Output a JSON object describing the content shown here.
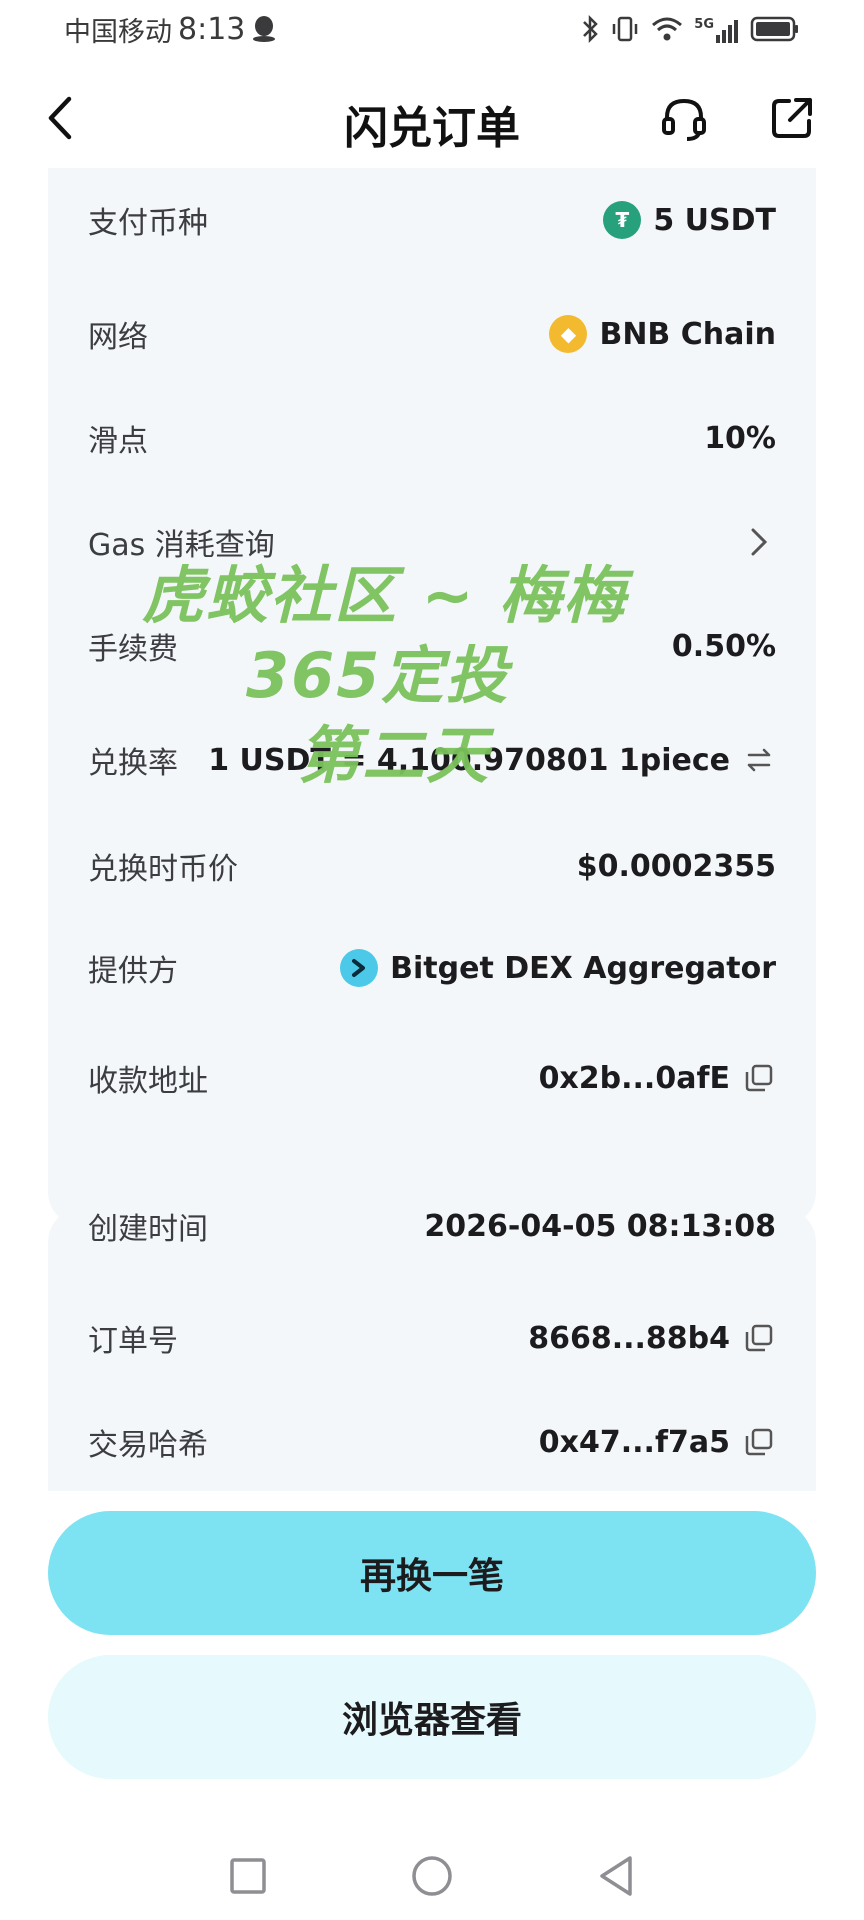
{
  "status_bar": {
    "carrier": "中国移动",
    "time": "8:13",
    "network_label": "5G"
  },
  "header": {
    "title": "闪兑订单"
  },
  "card1": {
    "rows": [
      {
        "label": "支付币种",
        "value": "5 USDT",
        "icon": "usdt-icon"
      },
      {
        "label": "网络",
        "value": "BNB Chain",
        "icon": "bnb-icon"
      },
      {
        "label": "滑点",
        "value": "10%"
      },
      {
        "label": "Gas 消耗查询",
        "value": ""
      },
      {
        "label": "手续费",
        "value": "0.50%"
      }
    ]
  },
  "card2": {
    "rows": [
      {
        "label": "兑换率",
        "value": "1 USDT = 4,100.970801 1piece"
      },
      {
        "label": "兑换时币价",
        "value": "$0.0002355"
      },
      {
        "label": "提供方",
        "value": "Bitget DEX Aggregator",
        "icon": "provider-icon"
      },
      {
        "label": "收款地址",
        "value": "0x2b...0afE"
      }
    ]
  },
  "card3": {
    "rows": [
      {
        "label": "创建时间",
        "value": "2026-04-05 08:13:08"
      },
      {
        "label": "订单号",
        "value": "8668...88b4"
      },
      {
        "label": "交易哈希",
        "value": "0x47...f7a5"
      }
    ]
  },
  "watermark": {
    "line1": "虎蛟社区 ~ 梅梅",
    "line2": "365定投",
    "line3": "第二天"
  },
  "buttons": {
    "primary": "再换一笔",
    "secondary": "浏览器查看"
  },
  "colors": {
    "accent": "#7de2f2",
    "accent_light": "#e6f9fc",
    "card_bg": "#f4f7f9",
    "watermark": "#7ac25c",
    "usdt": "#26a17b",
    "bnb": "#f3ba2f"
  }
}
